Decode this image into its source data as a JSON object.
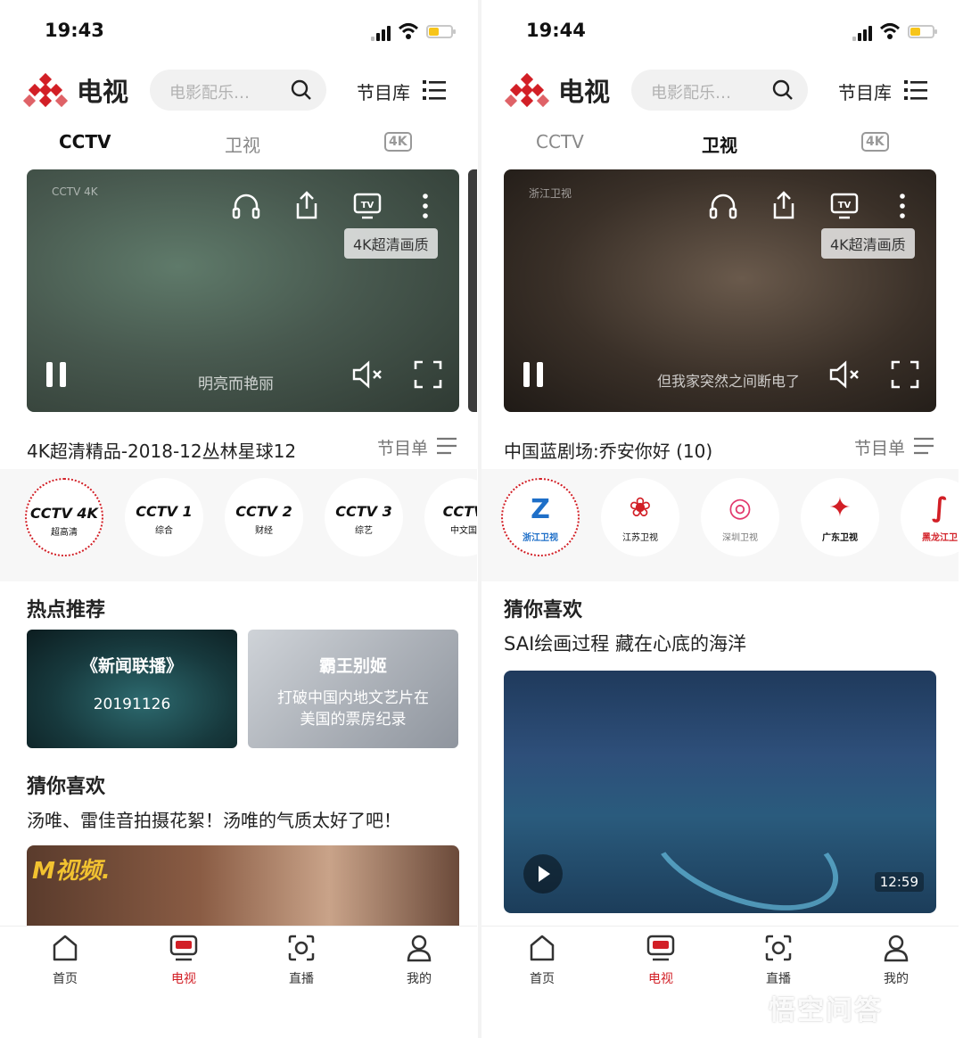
{
  "left": {
    "status_time": "19:43",
    "brand": "电视",
    "search_placeholder": "电影配乐…",
    "library_label": "节目库",
    "tabs": [
      "CCTV",
      "卫视",
      "4K"
    ],
    "active_tab": "CCTV",
    "player": {
      "quality_badge": "4K超清画质",
      "subtitle": "明亮而艳丽",
      "watermark": "CCTV 4K"
    },
    "program_title": "4K超清精品-2018-12丛林星球12",
    "program_list_label": "节目单",
    "channels": [
      {
        "logo": "CCTV 4K",
        "name": "超高清"
      },
      {
        "logo": "CCTV 1",
        "name": "综合"
      },
      {
        "logo": "CCTV 2",
        "name": "财经"
      },
      {
        "logo": "CCTV 3",
        "name": "综艺"
      },
      {
        "logo": "CCTV",
        "name": "中文国"
      }
    ],
    "hot_section_title": "热点推荐",
    "hot_cards": [
      {
        "title": "《新闻联播》",
        "subtitle": "20191126"
      },
      {
        "title": "霸王别姬",
        "line1": "打破中国内地文艺片在",
        "line2": "美国的票房纪录"
      }
    ],
    "guess_title": "猜你喜欢",
    "guess_subtitle": "汤唯、雷佳音拍摄花絮！汤唯的气质太好了吧！",
    "feed_logo": "M视频."
  },
  "right": {
    "status_time": "19:44",
    "brand": "电视",
    "search_placeholder": "电影配乐…",
    "library_label": "节目库",
    "tabs": [
      "CCTV",
      "卫视",
      "4K"
    ],
    "active_tab": "卫视",
    "player": {
      "quality_badge": "4K超清画质",
      "subtitle": "但我家突然之间断电了",
      "watermark": "浙江卫视"
    },
    "program_title": "中国蓝剧场:乔安你好 (10)",
    "program_list_label": "节目单",
    "channels": [
      {
        "logo": "浙江卫视"
      },
      {
        "logo": "江苏卫视"
      },
      {
        "logo": "深圳卫视"
      },
      {
        "logo": "广东卫视"
      },
      {
        "logo": "黑龙江卫"
      }
    ],
    "guess_title": "猜你喜欢",
    "guess_subtitle": "SAI绘画过程 藏在心底的海洋",
    "video_duration": "12:59"
  },
  "tabbar": [
    "首页",
    "电视",
    "直播",
    "我的"
  ],
  "active_tabbar": "电视",
  "watermark": "悟空问答",
  "colors": {
    "accent": "#d21f26",
    "battery": "#f7c51a"
  }
}
